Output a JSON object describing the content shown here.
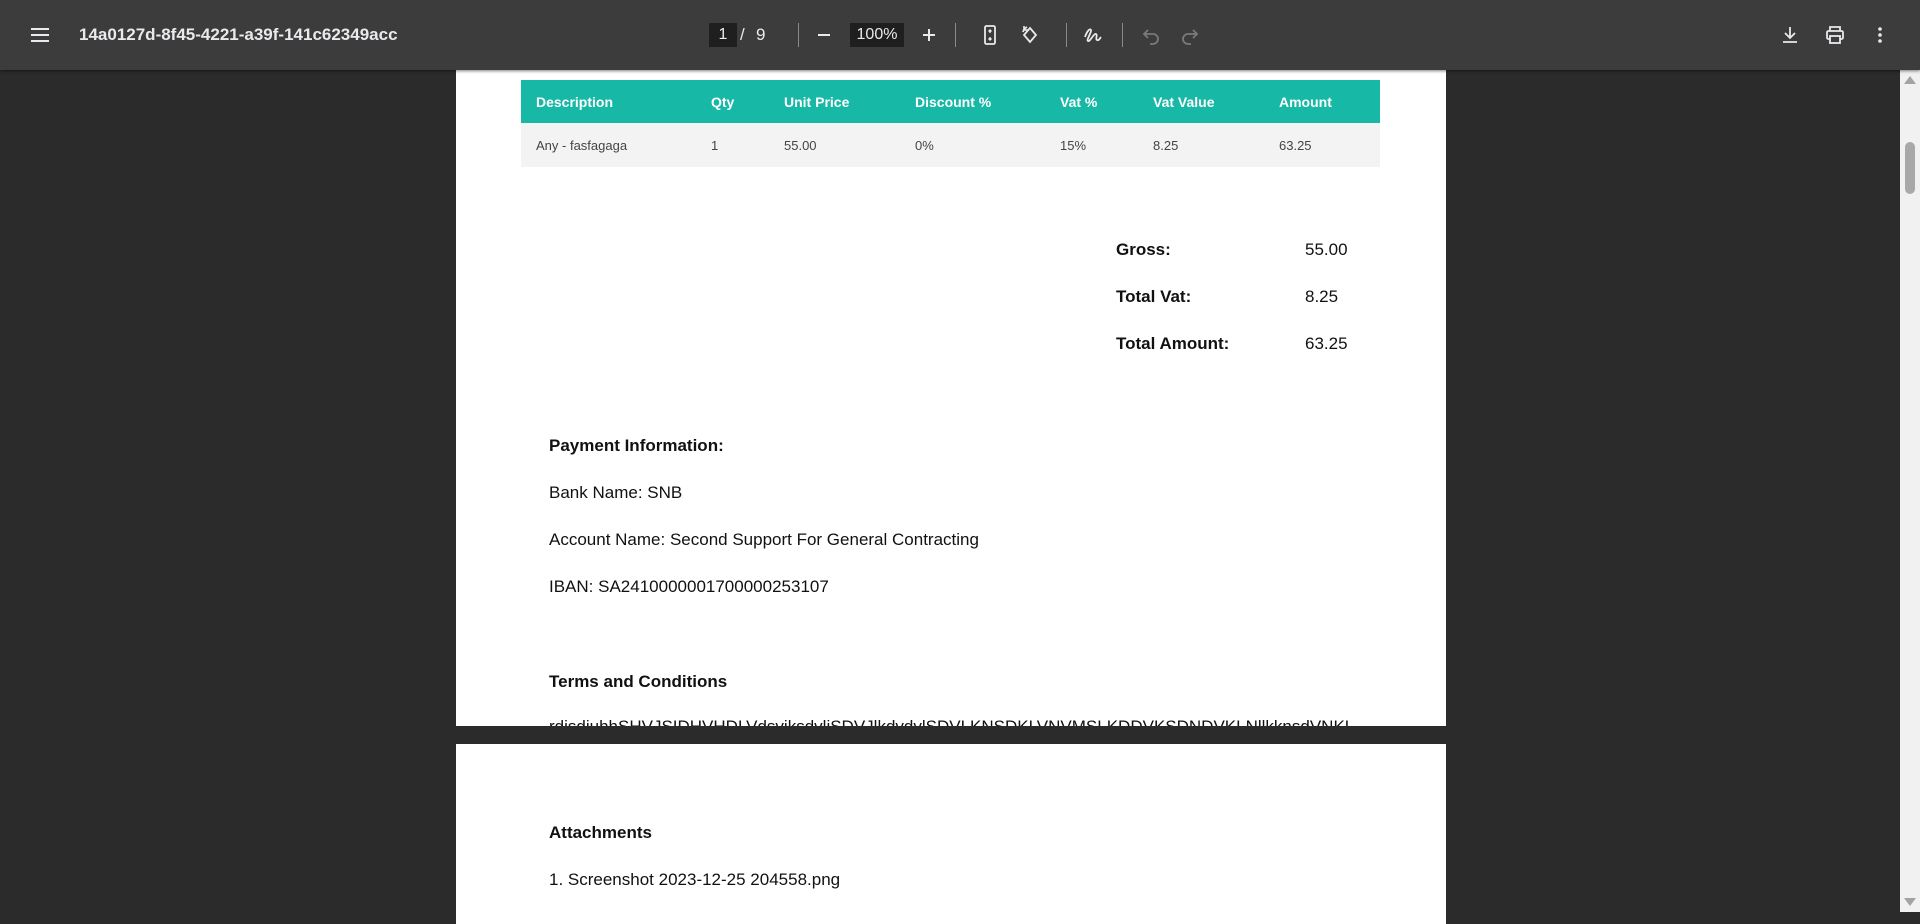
{
  "toolbar": {
    "menu_icon": "hamburger-menu-icon",
    "title": "14a0127d-8f45-4221-a39f-141c62349acc",
    "page_current": "1",
    "page_separator": "/",
    "page_total": "9",
    "zoom": "100%",
    "icons": {
      "zoom_out": "minus-icon",
      "zoom_in": "plus-icon",
      "fit_page": "fit-to-page-icon",
      "rotate": "rotate-counterclockwise-icon",
      "annotate": "draw-annotation-icon",
      "undo": "undo-icon",
      "redo": "redo-icon",
      "download": "download-icon",
      "print": "print-icon",
      "more": "more-vertical-icon"
    }
  },
  "invoice_table": {
    "headers": [
      "Description",
      "Qty",
      "Unit Price",
      "Discount %",
      "Vat %",
      "Vat Value",
      "Amount"
    ],
    "rows": [
      [
        "Any - fasfagaga",
        "1",
        "55.00",
        "0%",
        "15%",
        "8.25",
        "63.25"
      ]
    ]
  },
  "totals": {
    "gross_label": "Gross:",
    "gross_value": "55.00",
    "vat_label": "Total Vat:",
    "vat_value": "8.25",
    "amount_label": "Total Amount:",
    "amount_value": "63.25"
  },
  "payment": {
    "heading": "Payment Information:",
    "bank": "Bank Name: SNB",
    "account": "Account Name: Second Support For General Contracting",
    "iban": "IBAN: SA2410000001700000253107"
  },
  "terms": {
    "heading": "Terms and Conditions",
    "text": "rdjsdjuhhSHVJSIDHVHDLVdsvjksdvljSDVJlkdvdvlSDVLKNSDKLVNVMSLKDDVKSDNDVKLNllkknsdVNKLN"
  },
  "attachments": {
    "heading": "Attachments",
    "items": [
      "1. Screenshot 2023-12-25 204558.png"
    ]
  },
  "colors": {
    "table_header": "#17b8a6",
    "toolbar_bg": "#3c3c3c",
    "viewer_bg": "#2b2b2b"
  }
}
